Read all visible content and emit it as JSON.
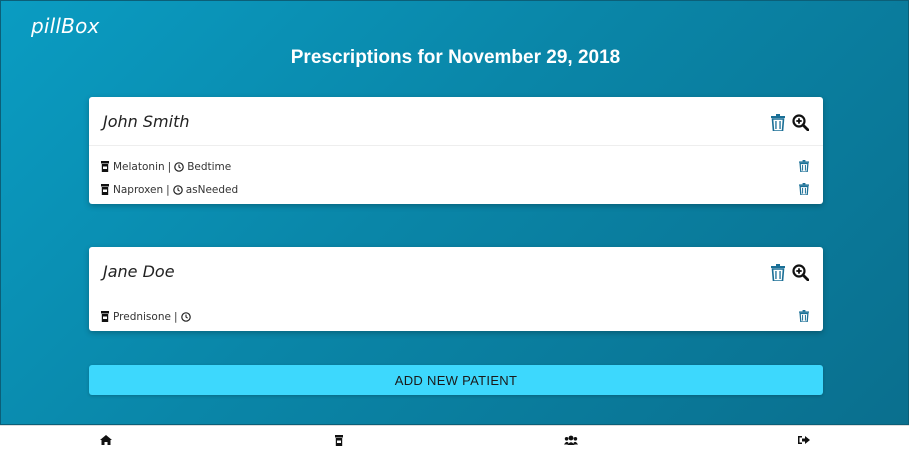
{
  "app": {
    "brand": "pillBox"
  },
  "header": {
    "title": "Prescriptions for November 29, 2018"
  },
  "patients": [
    {
      "name": "John Smith",
      "prescriptions": [
        {
          "drug": "Melatonin",
          "time": "Bedtime"
        },
        {
          "drug": "Naproxen",
          "time": "asNeeded"
        }
      ]
    },
    {
      "name": "Jane Doe",
      "prescriptions": [
        {
          "drug": "Prednisone",
          "time": ""
        }
      ]
    }
  ],
  "actions": {
    "add_patient_label": "ADD NEW PATIENT"
  },
  "footer": {
    "items": [
      {
        "icon": "home-icon"
      },
      {
        "icon": "pill-bottle-icon"
      },
      {
        "icon": "users-icon"
      },
      {
        "icon": "sign-out-icon"
      }
    ]
  },
  "colors": {
    "background_gradient_start": "#0a9cc2",
    "background_gradient_end": "#0a6f8e",
    "button_accent": "#3dd8fd",
    "icon_blue": "#1a6f96"
  }
}
